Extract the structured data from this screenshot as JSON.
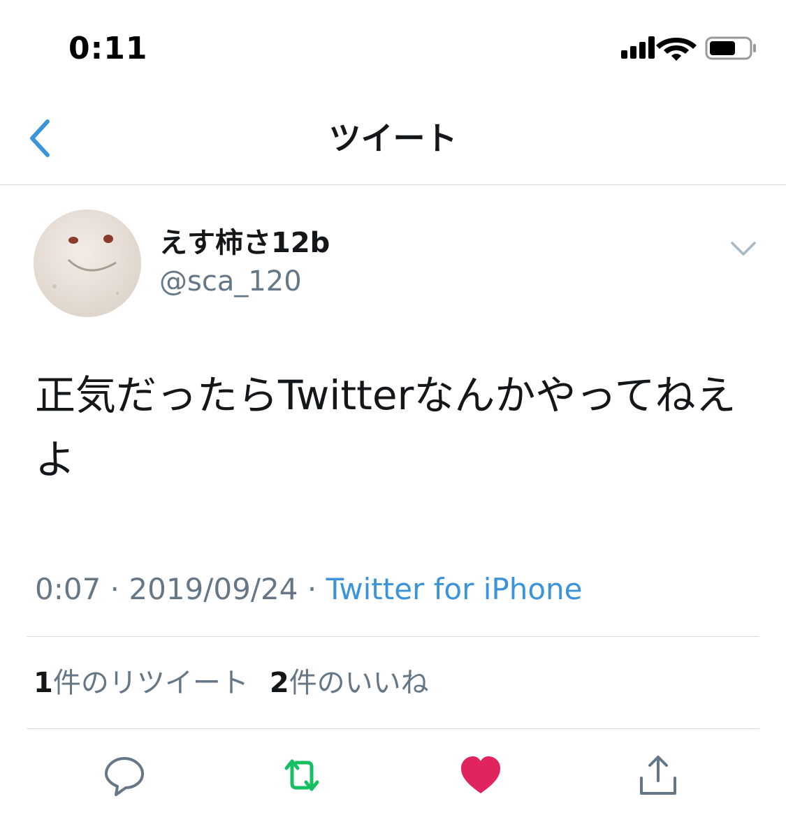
{
  "status_bar": {
    "time": "0:11",
    "icons": [
      "cellular-signal-icon",
      "wifi-icon",
      "battery-icon"
    ]
  },
  "nav": {
    "back_icon": "chevron-left-icon",
    "title": "ツイート"
  },
  "tweet": {
    "author": {
      "display_name": "えす柿さ12b",
      "handle": "@sca_120"
    },
    "text": "正気だったらTwitterなんかやってねえよ",
    "meta": {
      "time": "0:07",
      "separator": " · ",
      "date": "2019/09/24",
      "source": "Twitter for iPhone"
    },
    "stats": {
      "retweet_count": "1",
      "retweet_label": "件のリツイート",
      "like_count": "2",
      "like_label": "件のいいね"
    },
    "actions": [
      "reply-icon",
      "retweet-icon",
      "like-icon",
      "share-icon"
    ]
  },
  "colors": {
    "link": "#3b94d9",
    "retweet_active": "#17bf63",
    "like_active": "#e0245e",
    "secondary_text": "#657786",
    "primary_text": "#14171a"
  }
}
